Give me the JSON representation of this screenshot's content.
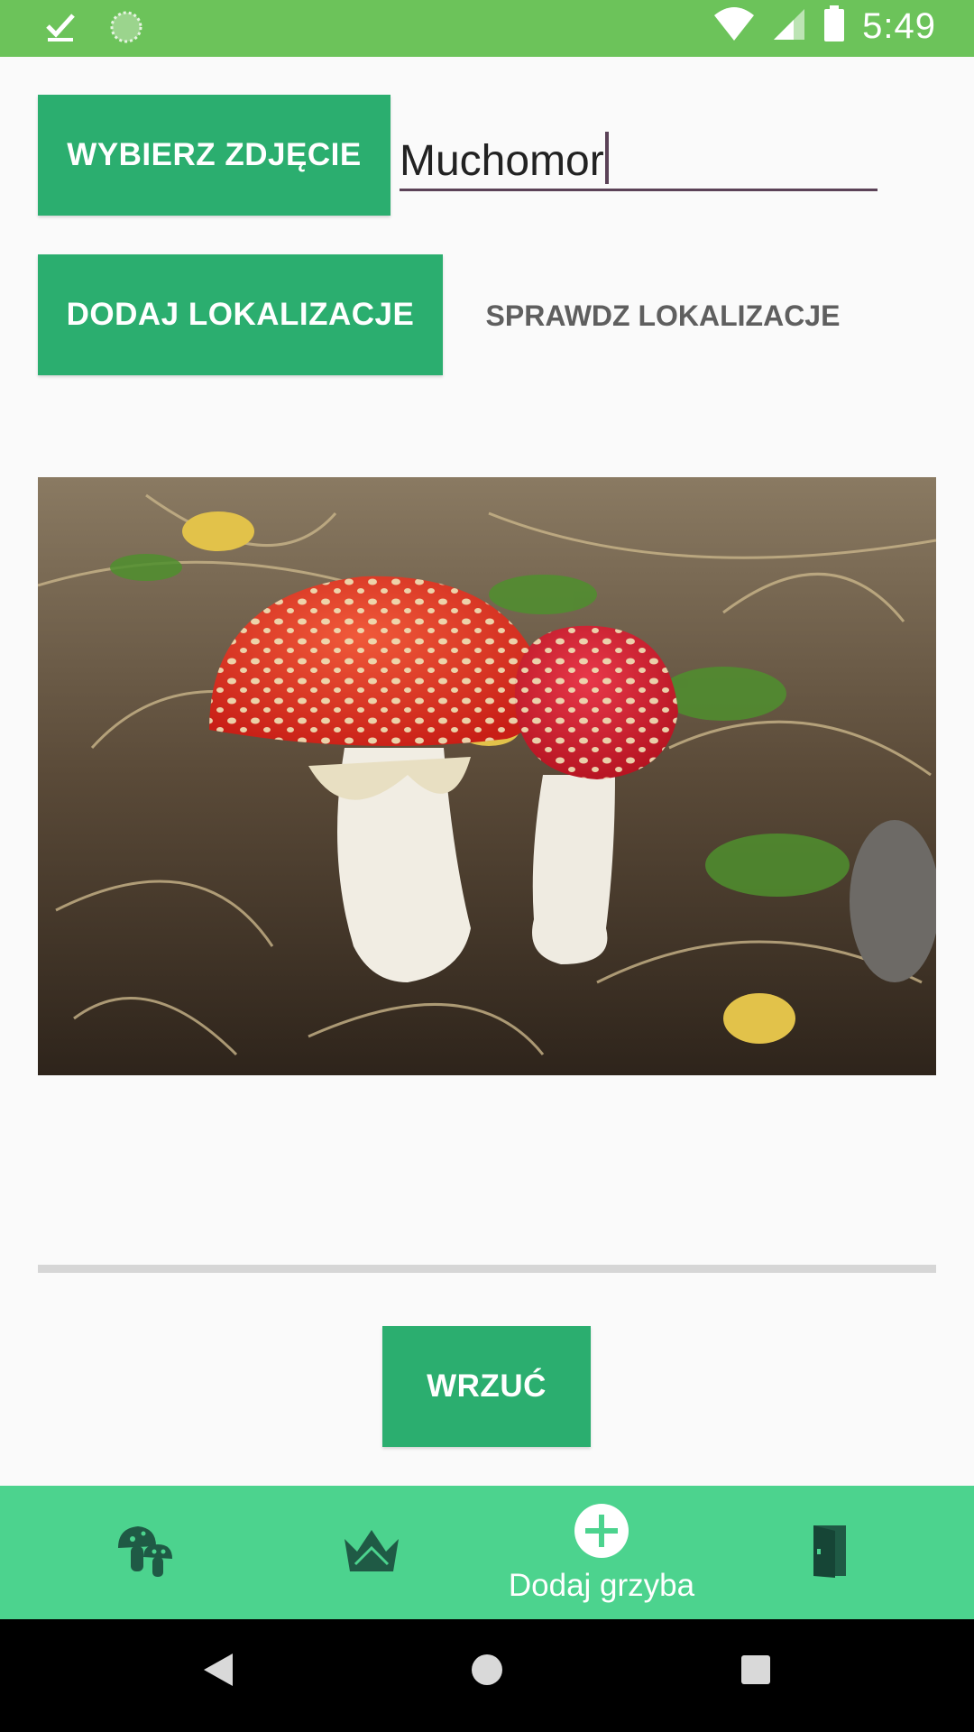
{
  "status_bar": {
    "time": "5:49",
    "icons": [
      "download-done-icon",
      "sync-icon",
      "wifi-icon",
      "cell-signal-icon",
      "battery-icon"
    ]
  },
  "form": {
    "choose_photo_label": "WYBIERZ ZDJĘCIE",
    "name_value": "Muchomor",
    "add_location_label": "DODAJ LOKALIZACJE",
    "check_location_label": "SPRAWDZ LOKALIZACJE",
    "upload_label": "WRZUĆ",
    "upload_progress": 0
  },
  "bottom_nav": {
    "items": [
      {
        "icon": "mushroom-icon",
        "label": ""
      },
      {
        "icon": "crown-icon",
        "label": ""
      },
      {
        "icon": "add-circle-icon",
        "label": "Dodaj grzyba"
      },
      {
        "icon": "door-exit-icon",
        "label": ""
      }
    ]
  },
  "colors": {
    "status_bar": "#6cc35a",
    "primary_button": "#2bae6f",
    "bottom_nav": "#4cd38e",
    "nav_icon": "#1f5a45"
  }
}
